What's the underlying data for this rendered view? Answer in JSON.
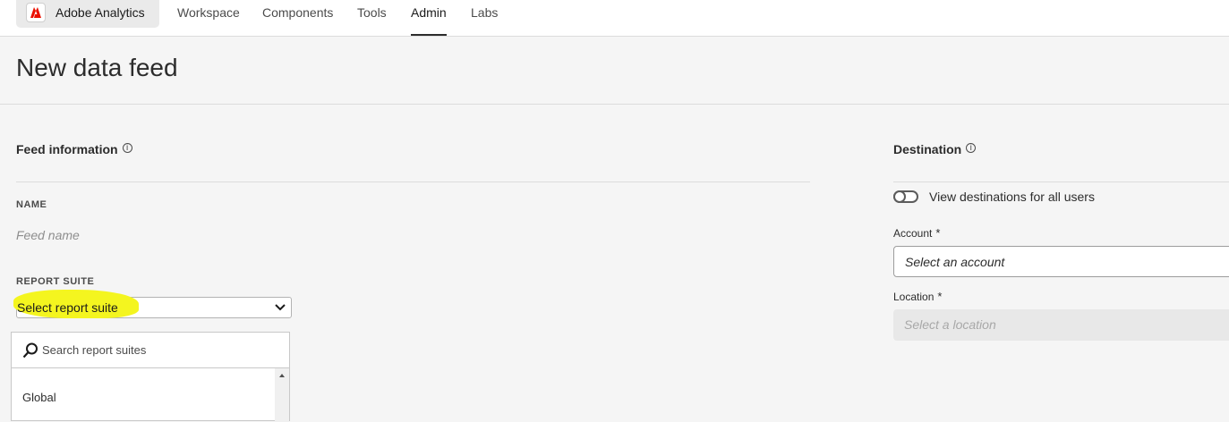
{
  "app": {
    "name": "Adobe Analytics",
    "brand_color": "#eb1000"
  },
  "nav": {
    "items": [
      {
        "label": "Workspace"
      },
      {
        "label": "Components"
      },
      {
        "label": "Tools"
      },
      {
        "label": "Admin",
        "active": true
      },
      {
        "label": "Labs"
      }
    ]
  },
  "page": {
    "title": "New data feed"
  },
  "feed_info": {
    "title": "Feed information",
    "info_icon": "info-icon",
    "name_label": "NAME",
    "name_placeholder": "Feed name",
    "report_suite_label": "REPORT SUITE",
    "report_suite_value": "Select report suite",
    "highlight_color": "#f4f51f",
    "search_placeholder": "Search report suites",
    "options": [
      "Global"
    ]
  },
  "destination": {
    "title": "Destination",
    "toggle_label": "View destinations for all users",
    "toggle_on": false,
    "account_label": "Account",
    "account_placeholder": "Select an account",
    "location_label": "Location",
    "location_placeholder": "Select a location",
    "required_mark": "*"
  }
}
